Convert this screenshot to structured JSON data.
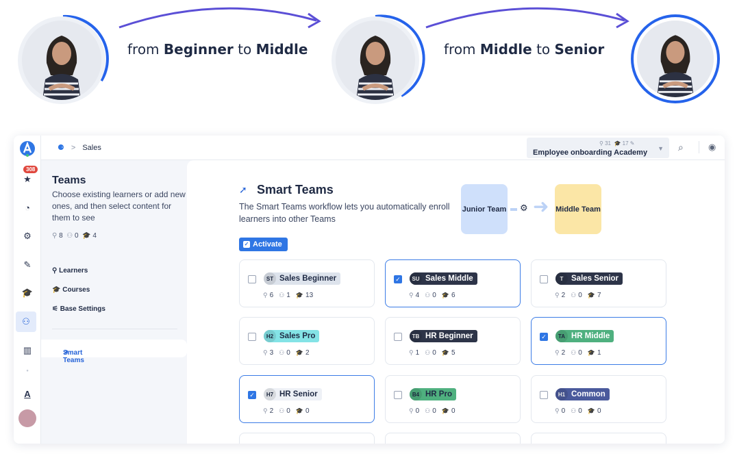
{
  "hero": {
    "step1": {
      "pre": "from ",
      "from": "Beginner",
      "mid": " to ",
      "to": "Middle"
    },
    "step2": {
      "pre": "from ",
      "from": "Middle",
      "mid": " to ",
      "to": "Senior"
    }
  },
  "colors": {
    "accent": "#2f76e4",
    "arrow": "#5b4fd6",
    "ring": "#2563eb"
  },
  "rail": {
    "notification_count": "308"
  },
  "breadcrumb": {
    "current": "Sales"
  },
  "academy": {
    "name": "Employee onboarding Academy",
    "learners": "31",
    "courses": "17"
  },
  "sidebar": {
    "title": "Teams",
    "description": "Choose existing learners or add new ones, and then select content for them to see",
    "stats": {
      "learners": "8",
      "managers": "0",
      "courses": "4"
    },
    "nav": [
      {
        "label": "Learners",
        "icon": "user-icon"
      },
      {
        "label": "Courses",
        "icon": "graduation-cap-icon"
      },
      {
        "label": "Base Settings",
        "icon": "sliders-icon"
      }
    ],
    "smart_teams": "Smart Teams"
  },
  "main": {
    "title": "Smart Teams",
    "description": "The Smart Teams workflow lets you automatically enroll learners into other Teams",
    "activate_label": "Activate",
    "diagram": {
      "from": "Junior Team",
      "to": "Middle Team"
    }
  },
  "teams": [
    {
      "abbr": "ST",
      "name": "Sales Beginner",
      "checked": false,
      "color": "#dde3ec",
      "text": "#1f2a44",
      "av": "#dde3ec",
      "avtext": "#1f2a44",
      "s1": "6",
      "s2": "1",
      "s3": "13"
    },
    {
      "abbr": "SU",
      "name": "Sales Middle",
      "checked": true,
      "color": "#2d3448",
      "text": "#ffffff",
      "av": "#2d3448",
      "avtext": "#ffffff",
      "s1": "4",
      "s2": "0",
      "s3": "6"
    },
    {
      "abbr": "T",
      "name": "Sales Senior",
      "checked": false,
      "color": "#2d3448",
      "text": "#ffffff",
      "av": "#2d3448",
      "avtext": "#ffffff",
      "s1": "2",
      "s2": "0",
      "s3": "7"
    },
    {
      "abbr": "H2",
      "name": "Sales Pro",
      "checked": false,
      "color": "#84e3e6",
      "text": "#1f2a44",
      "av": "#84e3e6",
      "avtext": "#1f2a44",
      "s1": "3",
      "s2": "0",
      "s3": "2"
    },
    {
      "abbr": "TB",
      "name": "HR Beginner",
      "checked": false,
      "color": "#2d3448",
      "text": "#ffffff",
      "av": "#2d3448",
      "avtext": "#ffffff",
      "s1": "1",
      "s2": "0",
      "s3": "5"
    },
    {
      "abbr": "TA",
      "name": "HR Middle",
      "checked": true,
      "color": "#4fb07f",
      "text": "#ffffff",
      "av": "#4fb07f",
      "avtext": "#1f2a44",
      "s1": "2",
      "s2": "0",
      "s3": "1"
    },
    {
      "abbr": "H7",
      "name": "HR Senior",
      "checked": true,
      "color": "#eef1f6",
      "text": "#1f2a44",
      "av": "#eef1f6",
      "avtext": "#1f2a44",
      "s1": "2",
      "s2": "0",
      "s3": "0"
    },
    {
      "abbr": "B4",
      "name": "HR Pro",
      "checked": false,
      "color": "#4fb07f",
      "text": "#1f2a44",
      "av": "#4fb07f",
      "avtext": "#1f2a44",
      "s1": "0",
      "s2": "0",
      "s3": "0"
    },
    {
      "abbr": "H1",
      "name": "Common",
      "checked": false,
      "color": "#4a5a9c",
      "text": "#ffffff",
      "av": "#4a5a9c",
      "avtext": "#ffffff",
      "s1": "0",
      "s2": "0",
      "s3": "0"
    }
  ]
}
